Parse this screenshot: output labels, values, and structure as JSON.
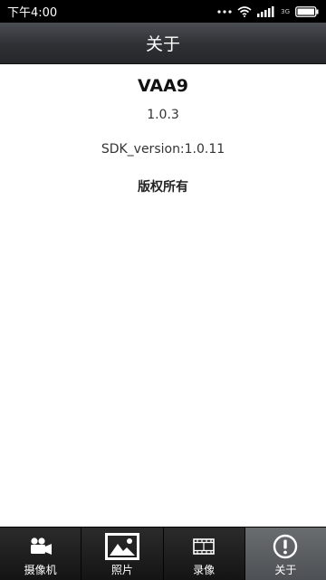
{
  "status_bar": {
    "time": "下午4:00",
    "network_label": "3G"
  },
  "header": {
    "title": "关于"
  },
  "about": {
    "app_name": "VAA9",
    "version": "1.0.3",
    "sdk_version": "SDK_version:1.0.11",
    "copyright": "版权所有"
  },
  "tabs": [
    {
      "label": "摄像机",
      "icon": "video-camera-icon",
      "active": false
    },
    {
      "label": "照片",
      "icon": "photo-icon",
      "active": false
    },
    {
      "label": "录像",
      "icon": "film-icon",
      "active": false
    },
    {
      "label": "关于",
      "icon": "info-icon",
      "active": true
    }
  ],
  "colors": {
    "header_bg": "#2e3034",
    "tab_bar_bg": "#1e1e1e",
    "tab_active_bg": "#5c5f63"
  }
}
